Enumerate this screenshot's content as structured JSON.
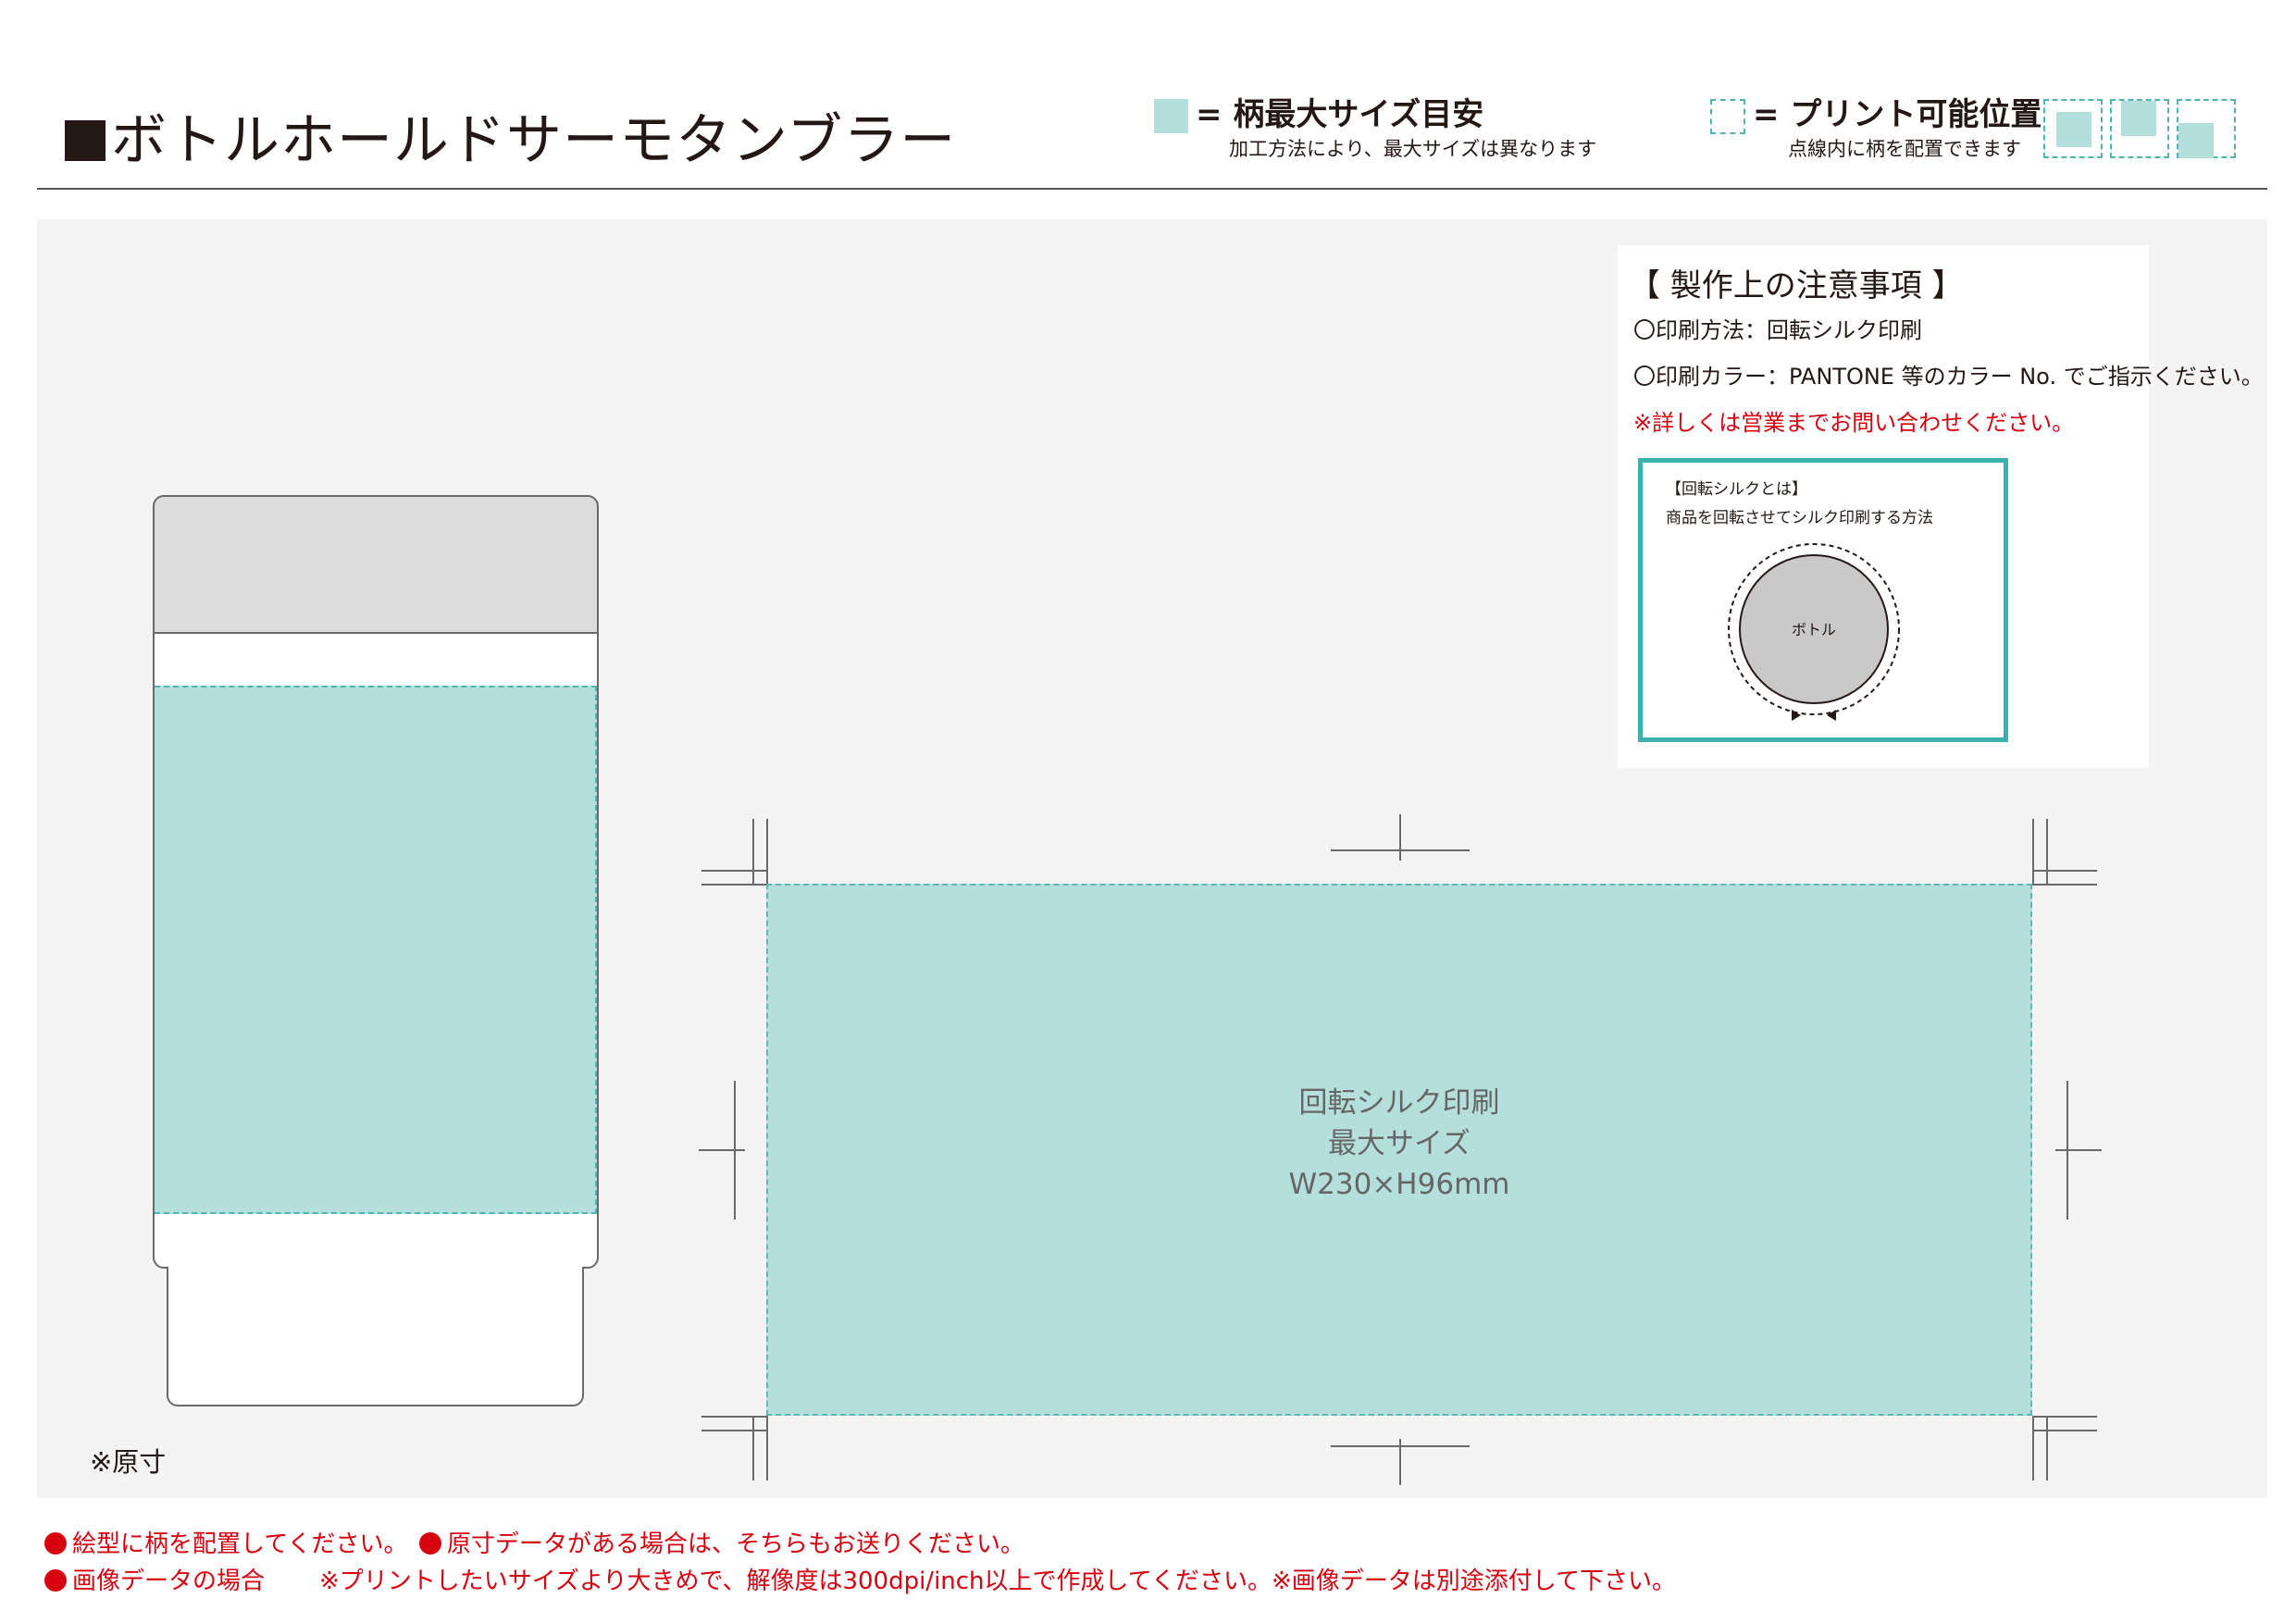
{
  "header": {
    "title": "ボトルホールドサーモタンブラー"
  },
  "legend": {
    "max_size": {
      "title": "= 柄最大サイズ目安",
      "sub": "加工方法により、最大サイズは異なります"
    },
    "print_position": {
      "title": "= プリント可能位置",
      "sub": "点線内に柄を配置できます"
    }
  },
  "drawing": {
    "actual_size_note": "※原寸",
    "art_area": {
      "line1": "回転シルク印刷",
      "line2": "最大サイズ",
      "line3": "W230×H96mm"
    }
  },
  "notes": {
    "title": "【 製作上の注意事項 】",
    "method": "〇印刷方法：回転シルク印刷",
    "color": "〇印刷カラー：PANTONE 等のカラー No. でご指示ください。",
    "contact": "※詳しくは営業までお問い合わせください。",
    "rotary": {
      "title": "【回転シルクとは】",
      "desc": "商品を回転させてシルク印刷する方法",
      "bottle": "ボトル"
    }
  },
  "footer": {
    "item1": "絵型に柄を配置してください。",
    "item2": "原寸データがある場合は、そちらもお送りください。",
    "item3": "画像データの場合",
    "item4": "※プリントしたいサイズより大きめで、解像度は300dpi/inch以上で作成してください。※画像データは別途添付して下さい。"
  },
  "colors": {
    "print_area": "#b5dfdc",
    "dash": "#4fb5b0",
    "accent_red": "#d7000f",
    "teal_frame": "#3bb0ac"
  }
}
